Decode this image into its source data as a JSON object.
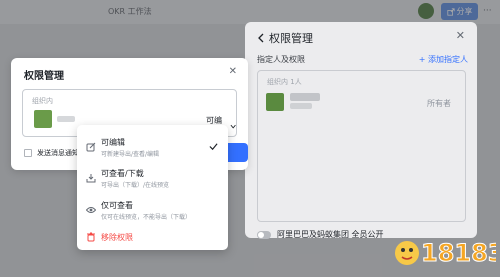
{
  "app": {
    "title": "OKR 工作法",
    "doc_title": "",
    "share_label": "分享",
    "more_label": "···"
  },
  "side_panel": {
    "title": "权限管理",
    "back_icon": "chevron-left-icon",
    "section_label": "指定人及权限",
    "add_label": "+ 添加指定人",
    "org_label": "组织内 1人",
    "owner_label": "所有者",
    "public_label": "阿里巴巴及蚂蚁集团 全员公开"
  },
  "dialog": {
    "title": "权限管理",
    "org_label": "组织内",
    "permission_label": "可编辑",
    "notify_label": "发送消息通知"
  },
  "dropdown": {
    "options": [
      {
        "label": "可编辑",
        "desc": "可新建导出/查看/编辑",
        "icon": "edit-icon",
        "selected": true
      },
      {
        "label": "可查看/下载",
        "desc": "可导出（下载）/在线预览",
        "icon": "download-icon",
        "selected": false
      },
      {
        "label": "仅可查看",
        "desc": "仅可在线预览，不能导出（下载）",
        "icon": "eye-icon",
        "selected": false
      }
    ],
    "remove_label": "移除权限",
    "remove_icon": "trash-icon"
  },
  "watermark": {
    "text": "18183"
  },
  "colors": {
    "accent": "#3370ff",
    "danger": "#f54a45",
    "share": "#5b8ce0"
  }
}
